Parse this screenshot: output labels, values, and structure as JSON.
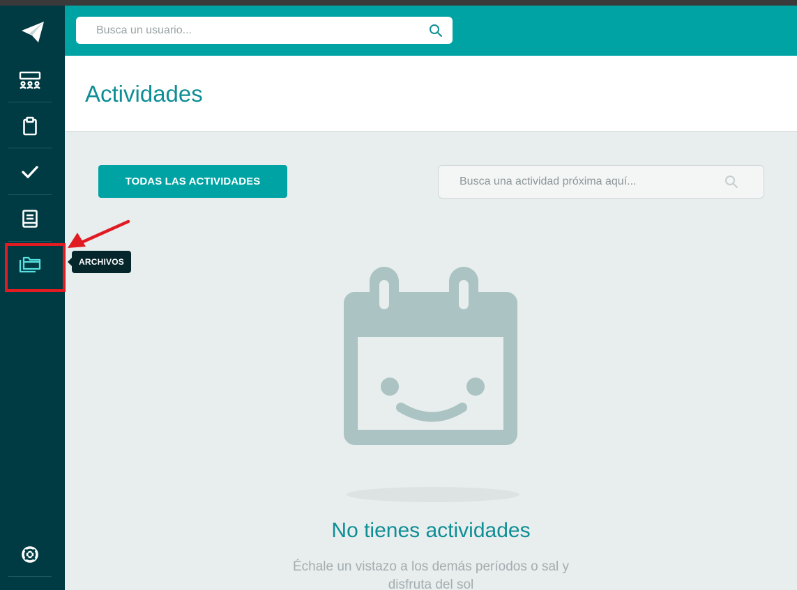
{
  "search": {
    "user_placeholder": "Busca un usuario...",
    "activity_placeholder": "Busca una actividad próxima aquí..."
  },
  "page": {
    "title": "Actividades"
  },
  "toolbar": {
    "all_activities_label": "TODAS LAS ACTIVIDADES"
  },
  "tooltip": {
    "label": "ARCHIVOS"
  },
  "sidebar": {
    "items": [
      {
        "icon": "send-icon"
      },
      {
        "icon": "group-icon"
      },
      {
        "icon": "clipboard-icon"
      },
      {
        "icon": "check-icon"
      },
      {
        "icon": "book-icon"
      },
      {
        "icon": "folders-icon"
      },
      {
        "icon": "lifebuoy-icon"
      }
    ]
  },
  "empty_state": {
    "title": "No tienes actividades",
    "subtitle": "Échale un vistazo a los demás períodos o sal y disfruta del sol"
  },
  "colors": {
    "sidebar": "#003b44",
    "accent": "#00a3a3",
    "title": "#0e8e95",
    "annotation": "#e11b22"
  }
}
